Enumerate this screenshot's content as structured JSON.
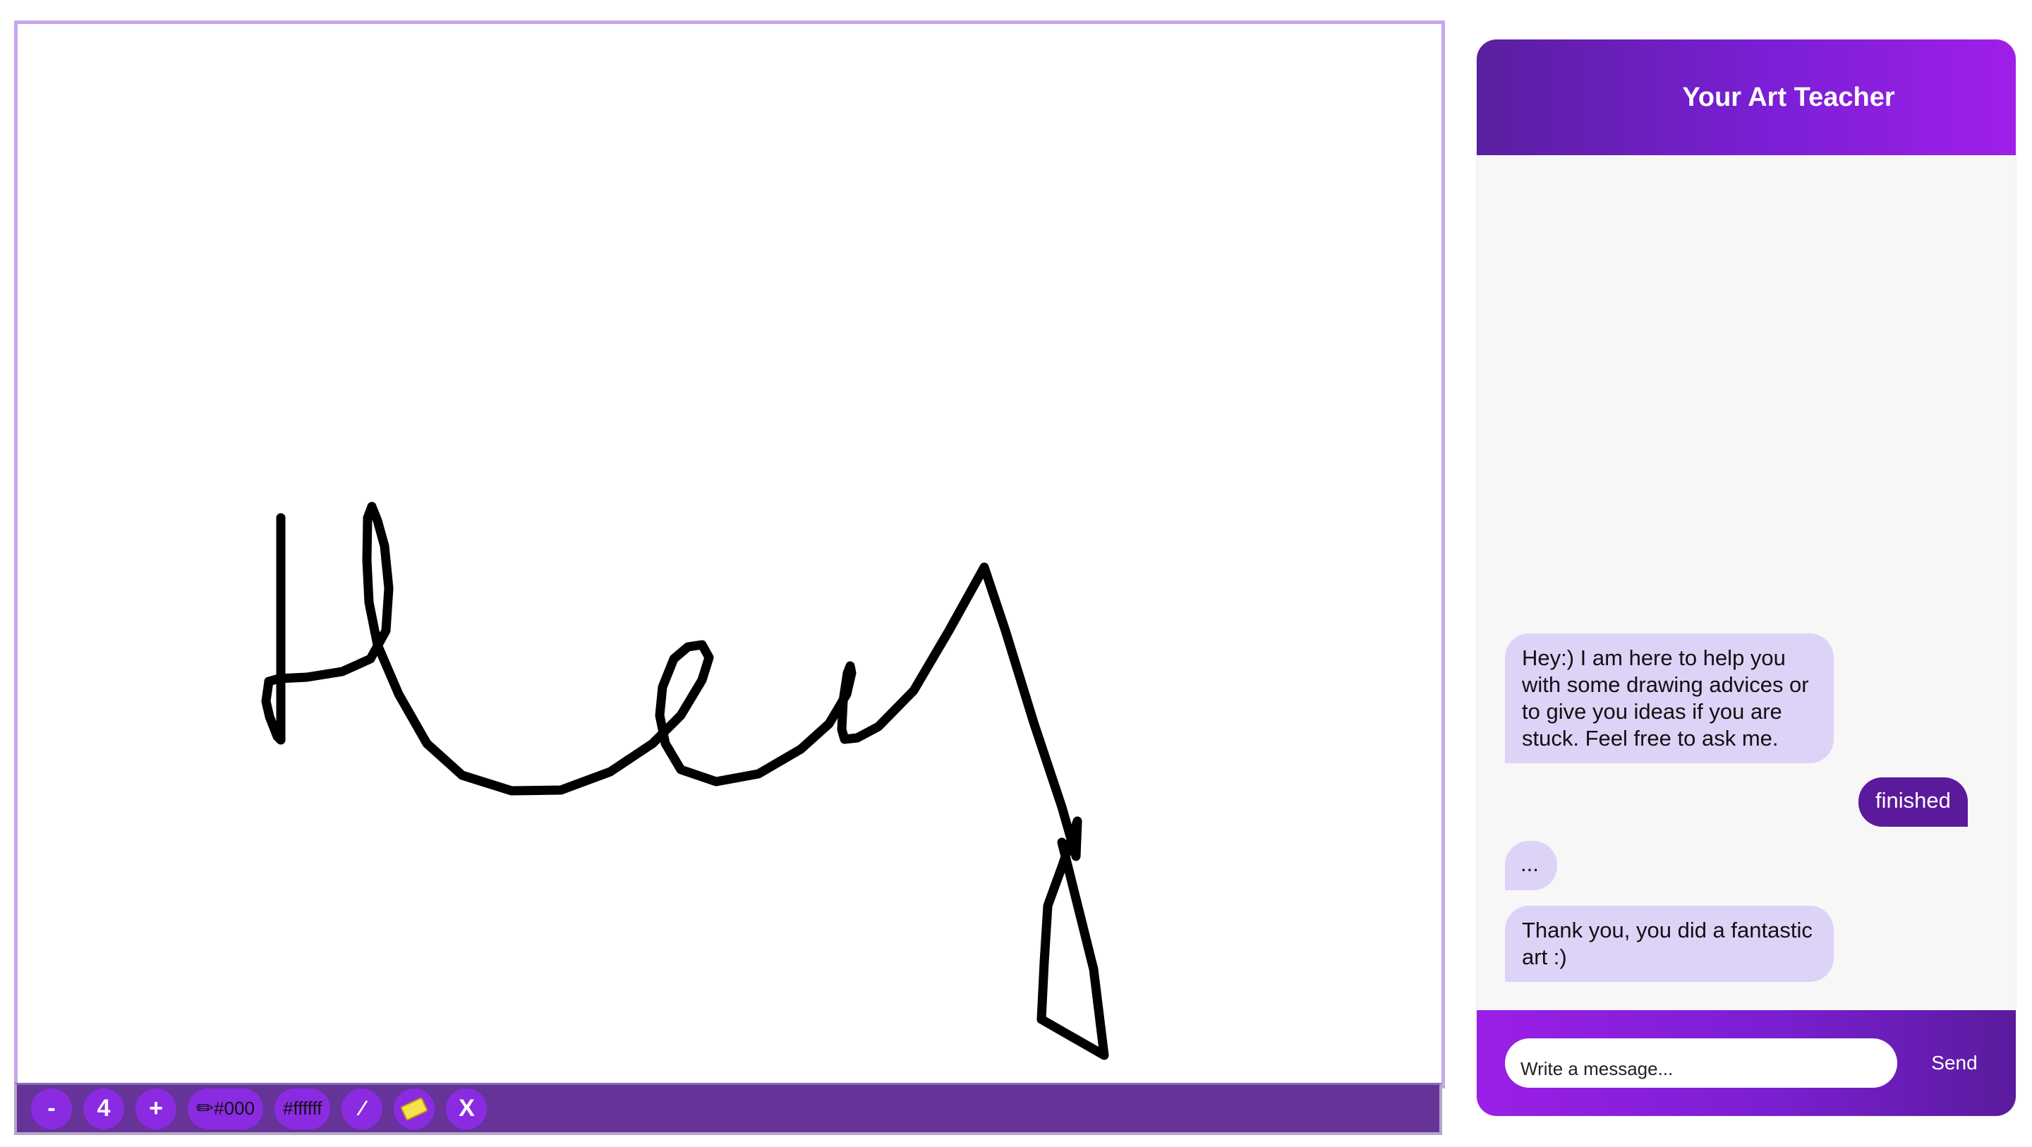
{
  "toolbar": {
    "decrease_label": "-",
    "brush_size": "4",
    "increase_label": "+",
    "pen_color_label": "#000",
    "bg_color_label": "#ffffff",
    "clear_label": "X",
    "icons": [
      "pencil-icon",
      "magic-wand-icon",
      "eraser-icon"
    ]
  },
  "chat": {
    "title": "Your Art Teacher",
    "messages": [
      {
        "sender": "bot",
        "text": "Hey:) I am here to help you with some drawing advices or to give you ideas if you are stuck. Feel free to ask me."
      },
      {
        "sender": "user",
        "text": "finished"
      },
      {
        "sender": "bot",
        "text": "..."
      },
      {
        "sender": "bot",
        "text": "Thank you, you did a fantastic art :)"
      }
    ],
    "input_placeholder": "Write a message...",
    "send_label": "Send"
  },
  "colors": {
    "accent": "#8a2be2",
    "toolbar_bg": "#663399",
    "bot_bubble": "#ddd3f7",
    "user_bubble": "#5b1a9c",
    "stroke": "#000000",
    "canvas_border": "#c7a6ec"
  }
}
